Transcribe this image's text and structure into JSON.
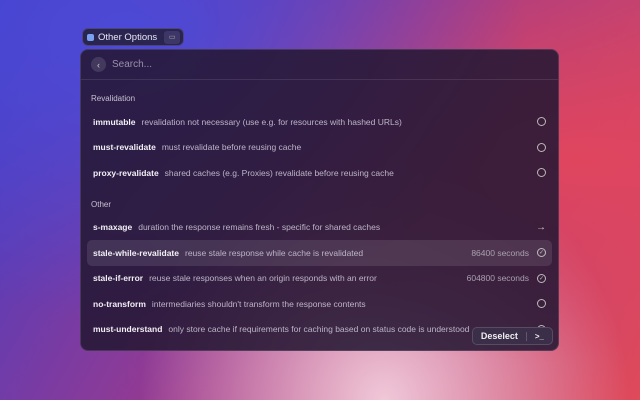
{
  "chip": {
    "label": "Other Options",
    "icon": "app-icon",
    "action_icon": "keyboard-icon"
  },
  "search": {
    "placeholder": "Search..."
  },
  "sections": [
    {
      "title": "Revalidation",
      "items": [
        {
          "title": "immutable",
          "desc": "revalidation not necessary (use e.g. for resources with hashed URLs)",
          "icon": "circle"
        },
        {
          "title": "must-revalidate",
          "desc": "must revalidate before reusing cache",
          "icon": "circle"
        },
        {
          "title": "proxy-revalidate",
          "desc": "shared caches (e.g. Proxies) revalidate before reusing cache",
          "icon": "circle"
        }
      ]
    },
    {
      "title": "Other",
      "items": [
        {
          "title": "s-maxage",
          "desc": "duration the response remains fresh - specific for shared caches",
          "icon": "arrow-right"
        },
        {
          "title": "stale-while-revalidate",
          "desc": "reuse stale response while cache is revalidated",
          "accessory": "86400 seconds",
          "icon": "check-circle",
          "selected": true
        },
        {
          "title": "stale-if-error",
          "desc": "reuse stale responses when an origin responds with an error",
          "accessory": "604800 seconds",
          "icon": "check-circle"
        },
        {
          "title": "no-transform",
          "desc": "intermediaries shouldn't transform the response contents",
          "icon": "circle"
        },
        {
          "title": "must-understand",
          "desc": "only store cache if requirements for caching based on status code is understood",
          "icon": "circle"
        }
      ]
    }
  ],
  "footer": {
    "action": "Deselect",
    "shortcut": ">_"
  }
}
